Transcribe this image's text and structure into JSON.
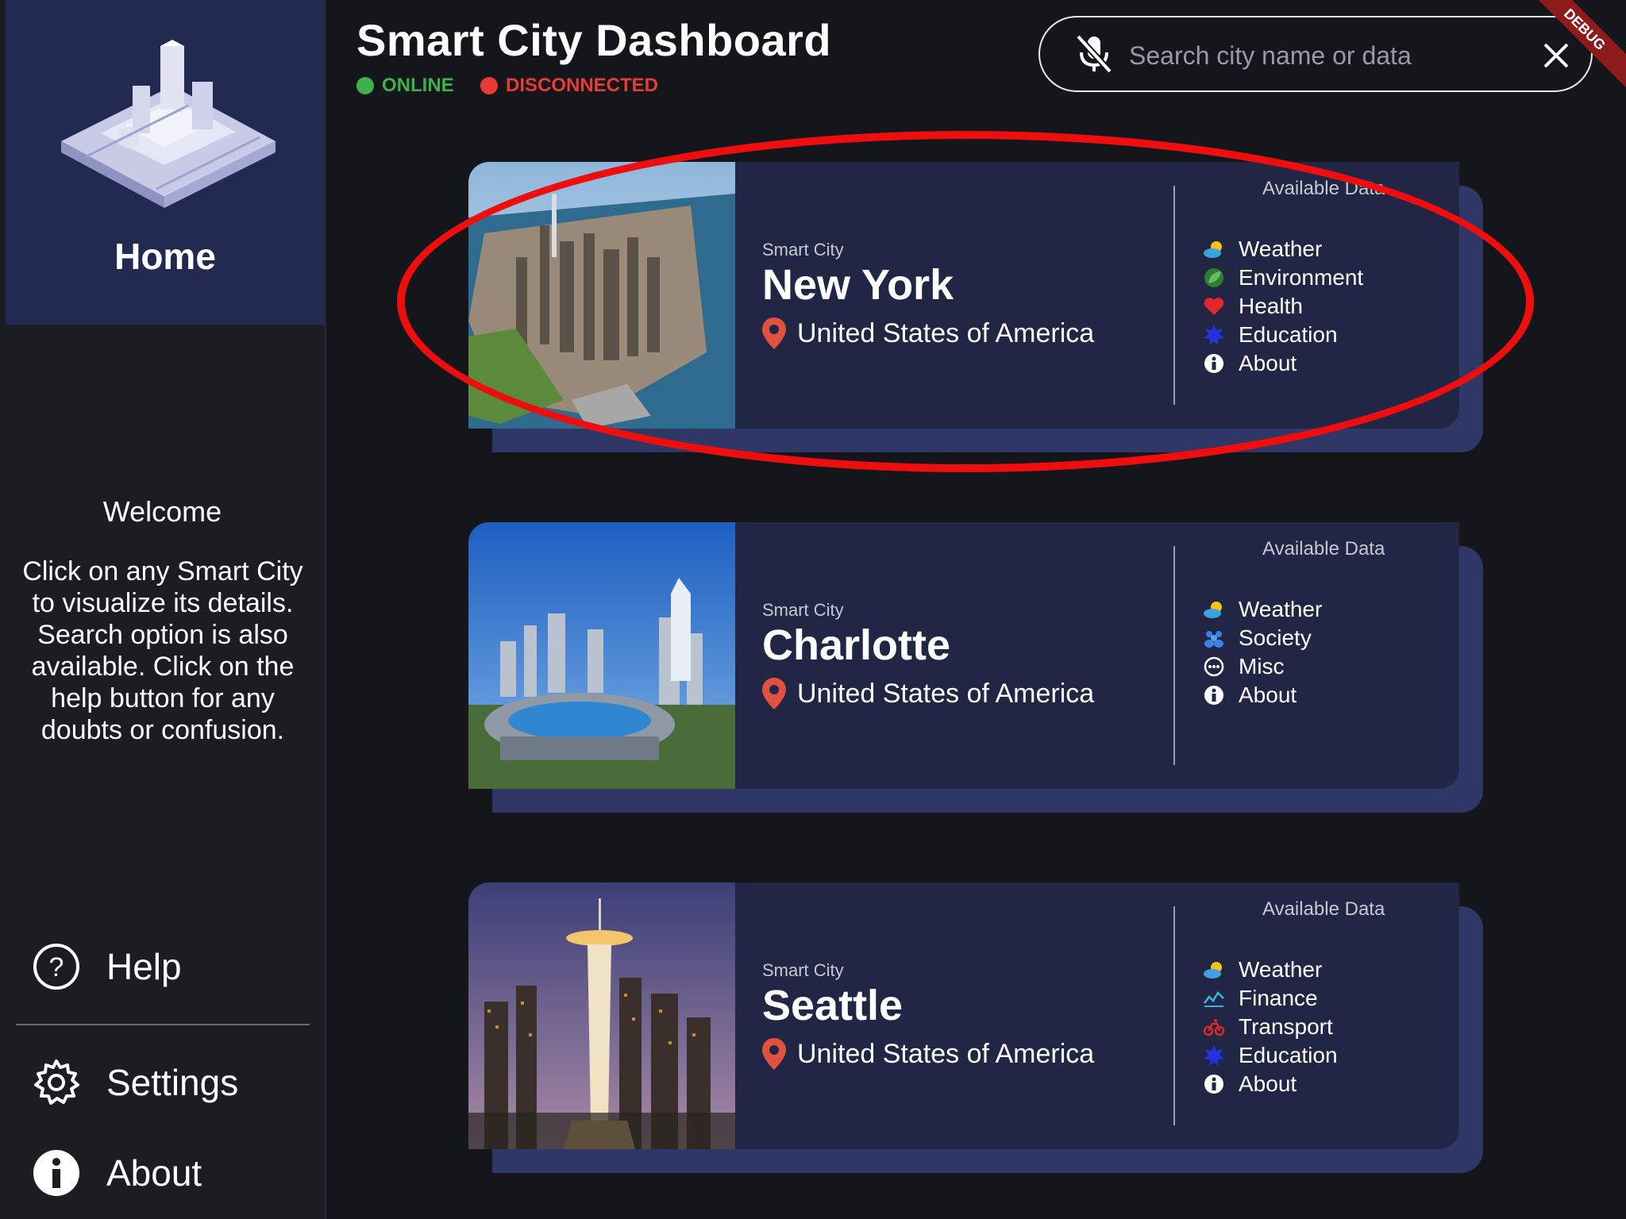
{
  "sidebar": {
    "home_label": "Home",
    "welcome_title": "Welcome",
    "welcome_text": "Click on any Smart City to visualize its details. Search option is also available. Click on the help button for any doubts or confusion.",
    "help_label": "Help",
    "settings_label": "Settings",
    "about_label": "About"
  },
  "header": {
    "title": "Smart City Dashboard",
    "status_online": "ONLINE",
    "status_disconnected": "DISCONNECTED",
    "search_placeholder": "Search city name or data",
    "debug_banner": "DEBUG"
  },
  "colors": {
    "online": "#3db24a",
    "disconnected": "#e63c35",
    "card_bg": "#222645",
    "card_shadow": "#2e3766",
    "highlight": "#ef0e0e"
  },
  "cards": [
    {
      "subtitle": "Smart City",
      "name": "New York",
      "country": "United States of America",
      "available_label": "Available Data",
      "data": [
        {
          "label": "Weather",
          "icon": "weather-icon"
        },
        {
          "label": "Environment",
          "icon": "environment-icon"
        },
        {
          "label": "Health",
          "icon": "health-icon"
        },
        {
          "label": "Education",
          "icon": "education-icon"
        },
        {
          "label": "About",
          "icon": "info-icon"
        }
      ]
    },
    {
      "subtitle": "Smart City",
      "name": "Charlotte",
      "country": "United States of America",
      "available_label": "Available Data",
      "data": [
        {
          "label": "Weather",
          "icon": "weather-icon"
        },
        {
          "label": "Society",
          "icon": "society-icon"
        },
        {
          "label": "Misc",
          "icon": "misc-icon"
        },
        {
          "label": "About",
          "icon": "info-icon"
        }
      ]
    },
    {
      "subtitle": "Smart City",
      "name": "Seattle",
      "country": "United States of America",
      "available_label": "Available Data",
      "data": [
        {
          "label": "Weather",
          "icon": "weather-icon"
        },
        {
          "label": "Finance",
          "icon": "finance-icon"
        },
        {
          "label": "Transport",
          "icon": "transport-icon"
        },
        {
          "label": "Education",
          "icon": "education-icon"
        },
        {
          "label": "About",
          "icon": "info-icon"
        }
      ]
    }
  ]
}
